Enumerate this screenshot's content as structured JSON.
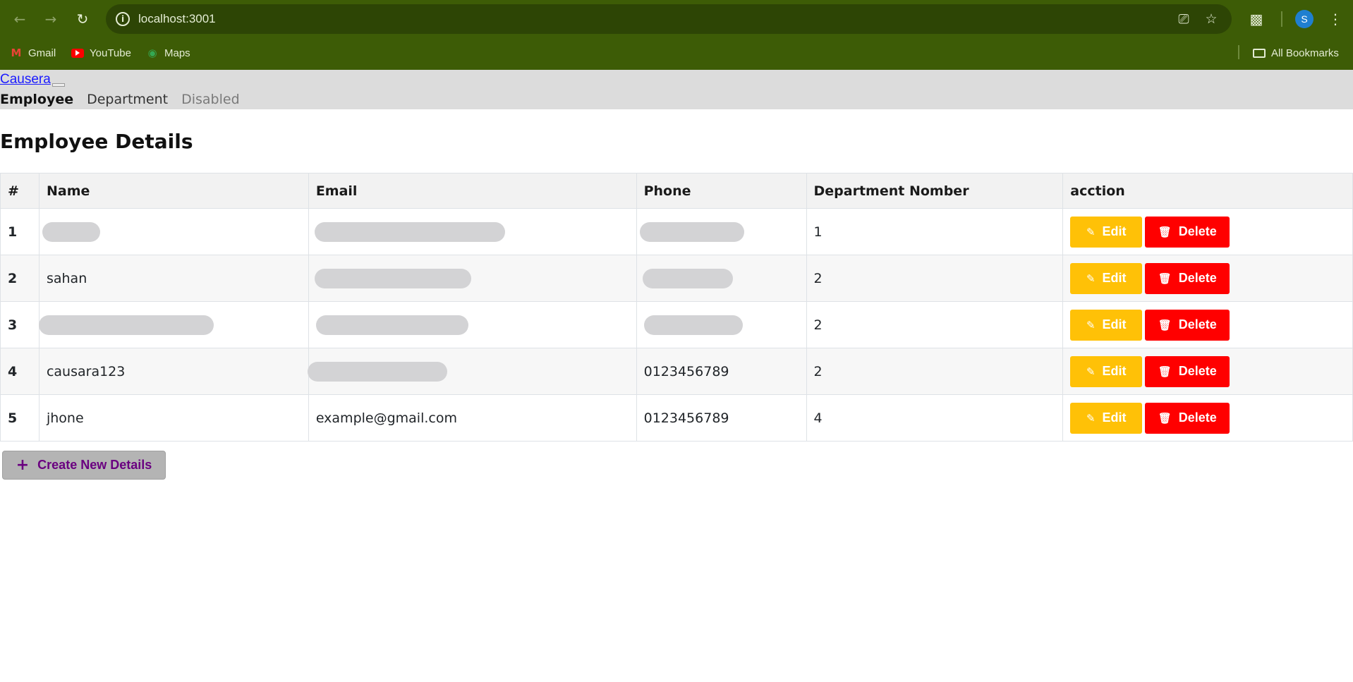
{
  "browser": {
    "url": "localhost:3001",
    "profile_initial": "S",
    "bookmarks": [
      {
        "label": "Gmail",
        "icon": "gmail-icon"
      },
      {
        "label": "YouTube",
        "icon": "youtube-icon"
      },
      {
        "label": "Maps",
        "icon": "maps-icon"
      }
    ],
    "all_bookmarks_label": "All Bookmarks"
  },
  "navbar": {
    "brand": "Causera",
    "links": [
      {
        "label": "Employee",
        "state": "active"
      },
      {
        "label": "Department",
        "state": "normal"
      },
      {
        "label": "Disabled",
        "state": "disabled"
      }
    ]
  },
  "main": {
    "title": "Employee Details",
    "table": {
      "columns": [
        "#",
        "Name",
        "Email",
        "Phone",
        "Department Nomber",
        "acction"
      ],
      "rows": [
        {
          "index": "1",
          "name": "",
          "email": "",
          "phone": "",
          "department": "1"
        },
        {
          "index": "2",
          "name": "sahan",
          "email": "",
          "phone": "",
          "department": "2"
        },
        {
          "index": "3",
          "name": "",
          "email": "",
          "phone": "",
          "department": "2"
        },
        {
          "index": "4",
          "name": "causara123",
          "email": "",
          "phone": "0123456789",
          "department": "2"
        },
        {
          "index": "5",
          "name": "jhone",
          "email": "example@gmail.com",
          "phone": "0123456789",
          "department": "4"
        }
      ],
      "edit_label": "Edit",
      "delete_label": "Delete"
    },
    "create_button_label": "Create New Details"
  },
  "colors": {
    "browser_frame": "#3d5c06",
    "navbar_bg": "#dcdcdc",
    "edit_button": "#ffc107",
    "delete_button": "#ff0000",
    "create_button_bg": "#b4b4b4",
    "create_button_text": "#6a0080"
  }
}
